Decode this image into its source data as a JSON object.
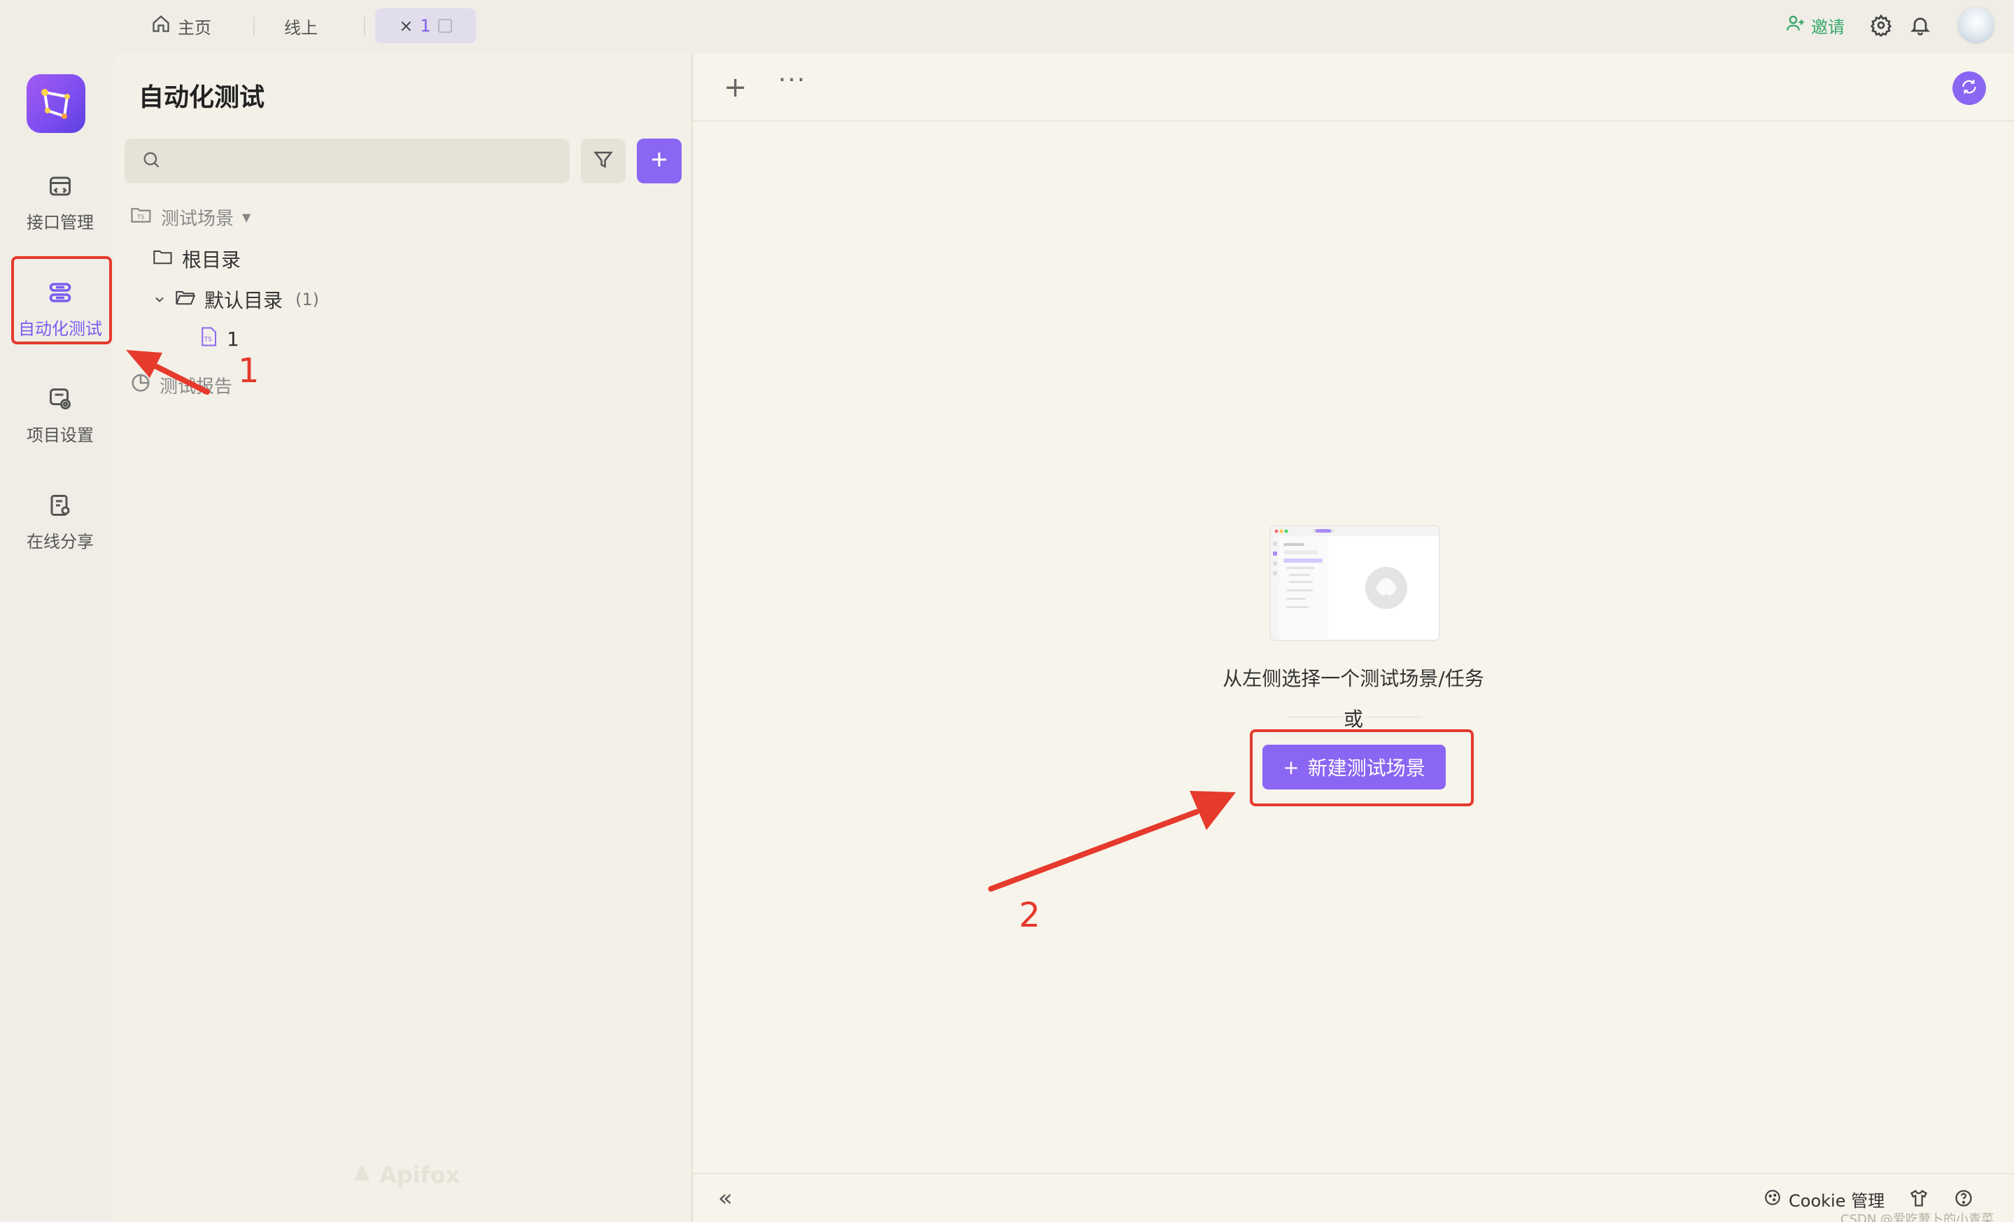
{
  "topbar": {
    "tabs": [
      {
        "label": "主页",
        "icon": "home-icon"
      },
      {
        "label": "线上"
      },
      {
        "label": "1",
        "close": "×",
        "icon": "external-window-icon"
      }
    ],
    "invite_label": "邀请",
    "icons": [
      "user-plus-icon",
      "gear-icon",
      "bell-icon",
      "avatar"
    ]
  },
  "rail": {
    "items": [
      {
        "label": "接口管理",
        "icon": "api-icon"
      },
      {
        "label": "自动化测试",
        "icon": "automation-icon",
        "active": true
      },
      {
        "label": "项目设置",
        "icon": "project-settings-icon"
      },
      {
        "label": "在线分享",
        "icon": "share-icon"
      }
    ]
  },
  "panel": {
    "title": "自动化测试",
    "search_placeholder": "",
    "tree": {
      "section_label": "测试场景",
      "root_label": "根目录",
      "default_folder_label": "默认目录",
      "default_folder_count": "(1)",
      "scenario_label": "1",
      "report_label": "测试报告"
    },
    "watermark": "Apifox"
  },
  "main": {
    "toolbar": {
      "plus": "+",
      "more": "···"
    },
    "empty_text": "从左侧选择一个测试场景/任务",
    "or_text": "或",
    "new_button_label": "新建测试场景",
    "new_button_icon": "+"
  },
  "bottom": {
    "collapse": "«",
    "cookie_label": "Cookie 管理",
    "watermark": "CSDN @爱吃萝卜的小青菜"
  },
  "annotations": {
    "num1": "1",
    "num2": "2",
    "color": "#e53a2c"
  },
  "colors": {
    "accent": "#8b66f2",
    "invite": "#35a86a",
    "annotation": "#e53a2c"
  }
}
